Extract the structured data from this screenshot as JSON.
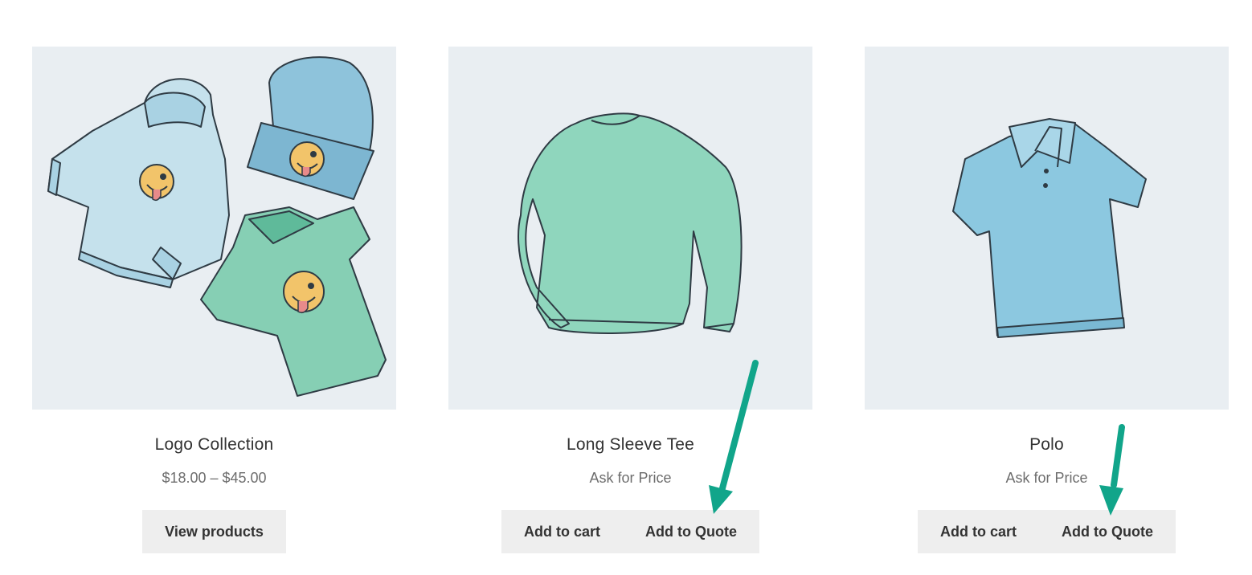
{
  "colors": {
    "image_bg": "#e9eef2",
    "button_bg": "#eeeeee",
    "arrow": "#11a58a",
    "title_text": "#333333",
    "price_text": "#6d6d6d"
  },
  "products": [
    {
      "title": "Logo Collection",
      "price": "$18.00 – $45.00",
      "image_icon": "clothing-collection-illustration",
      "buttons": [
        "View products"
      ]
    },
    {
      "title": "Long Sleeve Tee",
      "price": "Ask for Price",
      "image_icon": "long-sleeve-tee-illustration",
      "buttons": [
        "Add to cart",
        "Add to Quote"
      ]
    },
    {
      "title": "Polo",
      "price": "Ask for Price",
      "image_icon": "polo-shirt-illustration",
      "buttons": [
        "Add to cart",
        "Add to Quote"
      ]
    }
  ]
}
